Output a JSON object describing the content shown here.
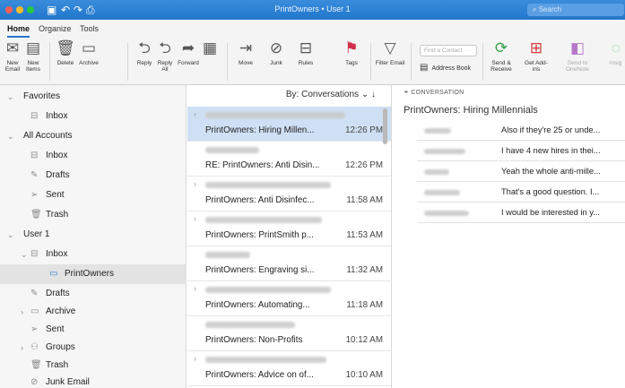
{
  "window": {
    "title": "PrintOwners • User 1",
    "search_placeholder": "Search",
    "colors": {
      "titlebar": "#2277cc",
      "selected_list": "#cfe0f4",
      "accent": "#2a75c9"
    }
  },
  "ribbon_tabs": [
    "Home",
    "Organize",
    "Tools"
  ],
  "ribbon": {
    "new_email": "New Email",
    "new_items": "New Items",
    "delete": "Delete",
    "archive": "Archive",
    "reply": "Reply",
    "reply_all": "Reply All",
    "forward": "Forward",
    "move": "Move",
    "junk": "Junk",
    "rules": "Rules",
    "tags": "Tags",
    "filter_email": "Filter Email",
    "find_contact_placeholder": "Find a Contact",
    "address_book": "Address Book",
    "send_receive": "Send & Receive",
    "get_addins": "Get Add-ins",
    "send_to_onenote": "Send to OneNote",
    "insights": "Insig"
  },
  "folders": {
    "favorites": "Favorites",
    "fav_inbox": "Inbox",
    "all_accounts": "All Accounts",
    "acc_inbox": "Inbox",
    "acc_drafts": "Drafts",
    "acc_sent": "Sent",
    "acc_trash": "Trash",
    "user1": "User 1",
    "user_inbox": "Inbox",
    "printowners": "PrintOwners",
    "user_drafts": "Drafts",
    "user_archive": "Archive",
    "user_sent": "Sent",
    "user_groups": "Groups",
    "user_trash": "Trash",
    "user_junk": "Junk Email"
  },
  "message_list": {
    "sort_label": "By: Conversations",
    "messages": [
      {
        "subject": "PrintOwners: Hiring Millen...",
        "time": "12:26 PM"
      },
      {
        "subject": "RE: PrintOwners: Anti Disin...",
        "time": "12:26 PM"
      },
      {
        "subject": "PrintOwners: Anti Disinfec...",
        "time": "11:58 AM"
      },
      {
        "subject": "PrintOwners: PrintSmith p...",
        "time": "11:53 AM"
      },
      {
        "subject": "PrintOwners: Engraving si...",
        "time": "11:32 AM"
      },
      {
        "subject": "PrintOwners: Automating...",
        "time": "11:18 AM"
      },
      {
        "subject": "PrintOwners: Non-Profits",
        "time": "10:12 AM"
      },
      {
        "subject": "PrintOwners: Advice on of...",
        "time": "10:10 AM"
      }
    ]
  },
  "reading_pane": {
    "label": "CONVERSATION",
    "title": "PrintOwners: Hiring Millennials",
    "thread": [
      "Also if they're 25 or unde...",
      "I have 4 new hires in thei...",
      "Yeah the whole anti-mille...",
      "That's a good question. I...",
      "I would be interested in y..."
    ]
  }
}
